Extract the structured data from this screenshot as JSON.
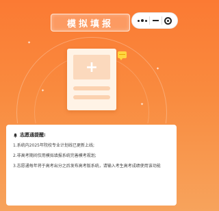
{
  "header": {
    "title": "模拟填报"
  },
  "capsule": {
    "more_icon": "more-dots-icon",
    "minimize_icon": "minimize-icon",
    "close_icon": "target-close-icon"
  },
  "illustration": {
    "plus_symbol": "+"
  },
  "notice": {
    "title": "志愿通提醒:",
    "items": [
      "1.系统内2025年院校专业计划线已更新上线;",
      "2.非高考期间仅用模拟填报系统完善模考规划;",
      "3.志愿通每年将于高考出分之后发布高考版系统，请输入考生高考成绩使用该功能"
    ]
  },
  "colors": {
    "background_top": "#fb7a33",
    "background_bottom": "#f7a35c",
    "card": "#ffffff",
    "chat_icon": "#ffd640"
  }
}
